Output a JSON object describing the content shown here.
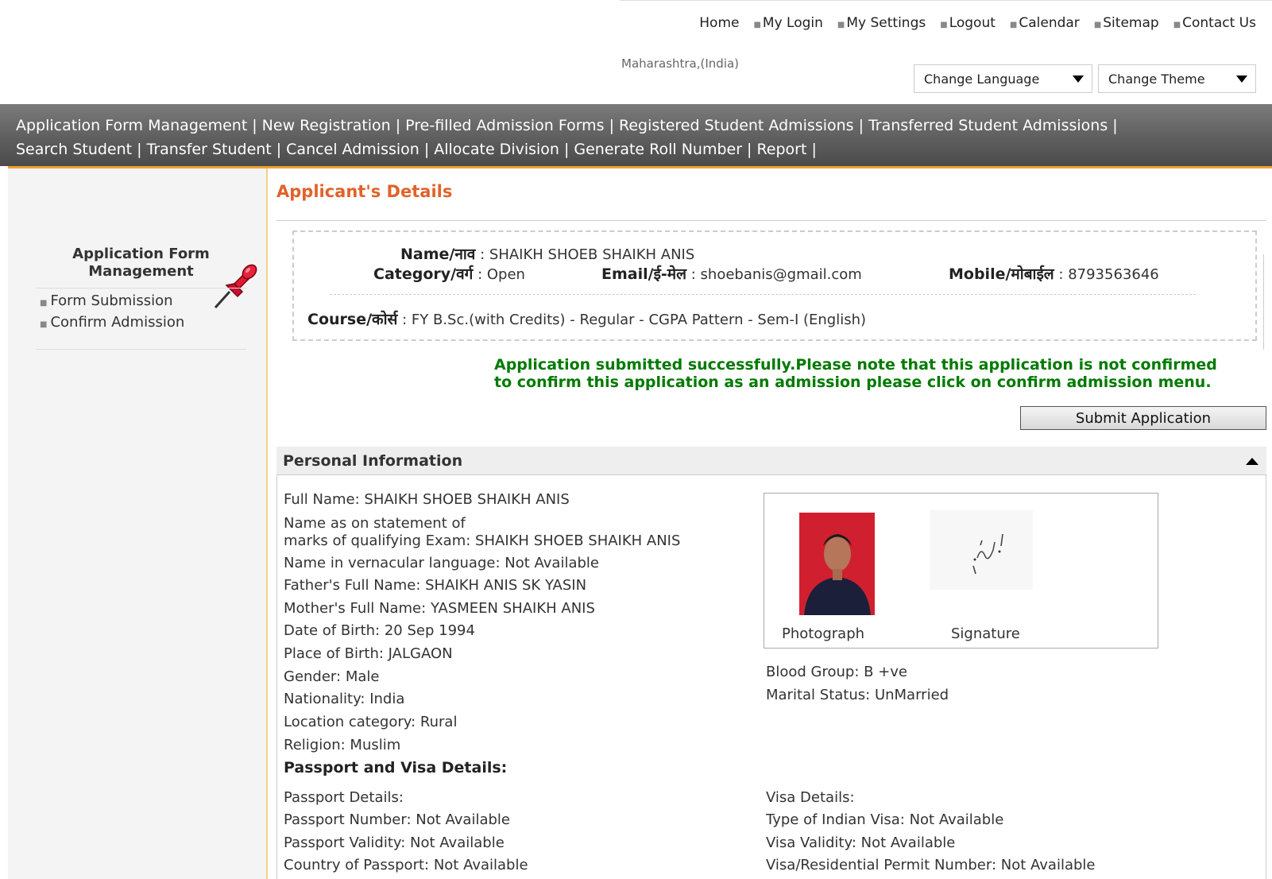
{
  "top_nav": {
    "links": [
      "Home",
      "My Login",
      "My Settings",
      "Logout",
      "Calendar",
      "Sitemap",
      "Contact Us"
    ]
  },
  "location": "Maharashtra,(India)",
  "language_dropdown": {
    "label": "Change Language"
  },
  "theme_dropdown": {
    "label": "Change Theme"
  },
  "menu": {
    "row1": [
      "Application Form Management",
      "New Registration",
      "Pre-filled Admission Forms",
      "Registered Student Admissions",
      "Transferred Student Admissions"
    ],
    "row2": [
      "Search Student",
      "Transfer Student",
      "Cancel Admission",
      "Allocate Division",
      "Generate Roll Number",
      "Report"
    ]
  },
  "sidebar": {
    "title": "Application Form Management",
    "items": [
      "Form Submission",
      "Confirm Admission"
    ]
  },
  "main": {
    "title": "Applicant's Details",
    "summary": {
      "name_label": "Name/नाव",
      "name_value": "SHAIKH SHOEB SHAIKH ANIS",
      "category_label": "Category/वर्ग",
      "category_value": "Open",
      "email_label": "Email/ई-मेल",
      "email_value": "shoebanis@gmail.com",
      "mobile_label": "Mobile/मोबाईल",
      "mobile_value": "8793563646",
      "course_label": "Course/कोर्स",
      "course_value": "FY B.Sc.(with Credits) - Regular - CGPA Pattern - Sem-I (English)"
    },
    "success_line1": "Application submitted successfully.Please note that this application is not confirmed",
    "success_line2": "to confirm this application as an admission please click on confirm admission menu.",
    "submit_label": "Submit Application"
  },
  "personal": {
    "header": "Personal Information",
    "full_name_label": "Full Name:",
    "full_name": "SHAIKH SHOEB SHAIKH ANIS",
    "statement_label_1": "Name as on statement of",
    "statement_label_2": "marks of qualifying Exam:",
    "statement_name": "SHAIKH SHOEB SHAIKH ANIS",
    "vernacular_label": "Name in vernacular language:",
    "vernacular": "Not Available",
    "father_label": "Father's Full Name:",
    "father": "SHAIKH ANIS SK YASIN",
    "mother_label": "Mother's Full Name:",
    "mother": "YASMEEN SHAIKH ANIS",
    "dob_label": "Date of Birth:",
    "dob": "20 Sep 1994",
    "pob_label": "Place of Birth:",
    "pob": "JALGAON",
    "gender_label": "Gender:",
    "gender": "Male",
    "nationality_label": "Nationality:",
    "nationality": "India",
    "location_label": "Location category:",
    "location": "Rural",
    "religion_label": "Religion:",
    "religion": "Muslim",
    "photo_label": "Photograph",
    "signature_label": "Signature",
    "blood_label": "Blood Group:",
    "blood": "B +ve",
    "marital_label": "Marital Status:",
    "marital": "UnMarried"
  },
  "passport": {
    "heading": "Passport and Visa Details:",
    "passport_details": "Passport Details:",
    "passport_number_label": "Passport Number:",
    "passport_number": "Not Available",
    "passport_validity_label": "Passport Validity:",
    "passport_validity": "Not Available",
    "country_label": "Country of Passport:",
    "country": "Not Available",
    "visa_details": "Visa Details:",
    "visa_type_label": "Type of Indian Visa:",
    "visa_type": "Not Available",
    "visa_validity_label": "Visa Validity:",
    "visa_validity": "Not Available",
    "permit_label": "Visa/Residential Permit Number:",
    "permit": "Not Available"
  },
  "colors": {
    "title_orange": "#e0632a",
    "success_green": "#007a00",
    "menu_gray": "#5c5c5c",
    "accent_underline": "#f0a030"
  }
}
